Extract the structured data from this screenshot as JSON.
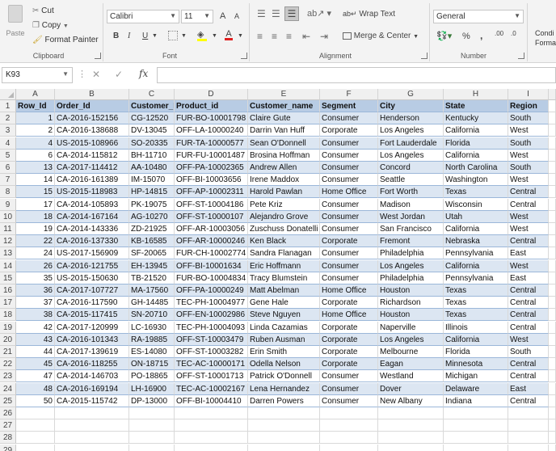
{
  "ribbon": {
    "clipboard": {
      "paste": "Paste",
      "cut": "Cut",
      "copy": "Copy",
      "format_painter": "Format Painter",
      "label": "Clipboard"
    },
    "font": {
      "name": "Calibri",
      "size": "11",
      "bold": "B",
      "italic": "I",
      "underline": "U",
      "grow": "A",
      "shrink": "A",
      "font_color": "A",
      "label": "Font"
    },
    "alignment": {
      "wrap_text": "Wrap Text",
      "merge_center": "Merge & Center",
      "label": "Alignment"
    },
    "number": {
      "format": "General",
      "percent": "%",
      "comma": ",",
      "inc_decimal": ".00",
      "dec_decimal": ".0",
      "label": "Number"
    },
    "styles": {
      "conditional": "Condi",
      "format_as": "Forma"
    }
  },
  "formula_bar": {
    "name_box": "K93",
    "fx": "fx",
    "value": ""
  },
  "columns": [
    "A",
    "B",
    "C",
    "D",
    "E",
    "F",
    "G",
    "H",
    "I"
  ],
  "table": {
    "headers": [
      "Row_Id",
      "Order_Id",
      "Customer_I",
      "Product_id",
      "Customer_name",
      "Segment",
      "City",
      "State",
      "Region"
    ],
    "rows": [
      [
        "1",
        "CA-2016-152156",
        "CG-12520",
        "FUR-BO-10001798",
        "Claire Gute",
        "Consumer",
        "Henderson",
        "Kentucky",
        "South"
      ],
      [
        "2",
        "CA-2016-138688",
        "DV-13045",
        "OFF-LA-10000240",
        "Darrin Van Huff",
        "Corporate",
        "Los Angeles",
        "California",
        "West"
      ],
      [
        "4",
        "US-2015-108966",
        "SO-20335",
        "FUR-TA-10000577",
        "Sean O'Donnell",
        "Consumer",
        "Fort Lauderdale",
        "Florida",
        "South"
      ],
      [
        "6",
        "CA-2014-115812",
        "BH-11710",
        "FUR-FU-10001487",
        "Brosina Hoffman",
        "Consumer",
        "Los Angeles",
        "California",
        "West"
      ],
      [
        "13",
        "CA-2017-114412",
        "AA-10480",
        "OFF-PA-10002365",
        "Andrew Allen",
        "Consumer",
        "Concord",
        "North Carolina",
        "South"
      ],
      [
        "14",
        "CA-2016-161389",
        "IM-15070",
        "OFF-BI-10003656",
        "Irene Maddox",
        "Consumer",
        "Seattle",
        "Washington",
        "West"
      ],
      [
        "15",
        "US-2015-118983",
        "HP-14815",
        "OFF-AP-10002311",
        "Harold Pawlan",
        "Home Office",
        "Fort Worth",
        "Texas",
        "Central"
      ],
      [
        "17",
        "CA-2014-105893",
        "PK-19075",
        "OFF-ST-10004186",
        "Pete Kriz",
        "Consumer",
        "Madison",
        "Wisconsin",
        "Central"
      ],
      [
        "18",
        "CA-2014-167164",
        "AG-10270",
        "OFF-ST-10000107",
        "Alejandro Grove",
        "Consumer",
        "West Jordan",
        "Utah",
        "West"
      ],
      [
        "19",
        "CA-2014-143336",
        "ZD-21925",
        "OFF-AR-10003056",
        "Zuschuss Donatelli",
        "Consumer",
        "San Francisco",
        "California",
        "West"
      ],
      [
        "22",
        "CA-2016-137330",
        "KB-16585",
        "OFF-AR-10000246",
        "Ken Black",
        "Corporate",
        "Fremont",
        "Nebraska",
        "Central"
      ],
      [
        "24",
        "US-2017-156909",
        "SF-20065",
        "FUR-CH-10002774",
        "Sandra Flanagan",
        "Consumer",
        "Philadelphia",
        "Pennsylvania",
        "East"
      ],
      [
        "26",
        "CA-2016-121755",
        "EH-13945",
        "OFF-BI-10001634",
        "Eric Hoffmann",
        "Consumer",
        "Los Angeles",
        "California",
        "West"
      ],
      [
        "35",
        "US-2015-150630",
        "TB-21520",
        "FUR-BO-10004834",
        "Tracy Blumstein",
        "Consumer",
        "Philadelphia",
        "Pennsylvania",
        "East"
      ],
      [
        "36",
        "CA-2017-107727",
        "MA-17560",
        "OFF-PA-10000249",
        "Matt Abelman",
        "Home Office",
        "Houston",
        "Texas",
        "Central"
      ],
      [
        "37",
        "CA-2016-117590",
        "GH-14485",
        "TEC-PH-10004977",
        "Gene Hale",
        "Corporate",
        "Richardson",
        "Texas",
        "Central"
      ],
      [
        "38",
        "CA-2015-117415",
        "SN-20710",
        "OFF-EN-10002986",
        "Steve Nguyen",
        "Home Office",
        "Houston",
        "Texas",
        "Central"
      ],
      [
        "42",
        "CA-2017-120999",
        "LC-16930",
        "TEC-PH-10004093",
        "Linda Cazamias",
        "Corporate",
        "Naperville",
        "Illinois",
        "Central"
      ],
      [
        "43",
        "CA-2016-101343",
        "RA-19885",
        "OFF-ST-10003479",
        "Ruben Ausman",
        "Corporate",
        "Los Angeles",
        "California",
        "West"
      ],
      [
        "44",
        "CA-2017-139619",
        "ES-14080",
        "OFF-ST-10003282",
        "Erin Smith",
        "Corporate",
        "Melbourne",
        "Florida",
        "South"
      ],
      [
        "45",
        "CA-2016-118255",
        "ON-18715",
        "TEC-AC-10000171",
        "Odella Nelson",
        "Corporate",
        "Eagan",
        "Minnesota",
        "Central"
      ],
      [
        "47",
        "CA-2014-146703",
        "PO-18865",
        "OFF-ST-10001713",
        "Patrick O'Donnell",
        "Consumer",
        "Westland",
        "Michigan",
        "Central"
      ],
      [
        "48",
        "CA-2016-169194",
        "LH-16900",
        "TEC-AC-10002167",
        "Lena Hernandez",
        "Consumer",
        "Dover",
        "Delaware",
        "East"
      ],
      [
        "50",
        "CA-2015-115742",
        "DP-13000",
        "OFF-BI-10004410",
        "Darren Powers",
        "Consumer",
        "New Albany",
        "Indiana",
        "Central"
      ]
    ]
  },
  "row_numbers": [
    "1",
    "2",
    "3",
    "4",
    "5",
    "6",
    "7",
    "8",
    "9",
    "10",
    "11",
    "12",
    "13",
    "14",
    "15",
    "16",
    "17",
    "18",
    "19",
    "20",
    "21",
    "22",
    "23",
    "24",
    "25",
    "26",
    "27",
    "28",
    "29"
  ],
  "colors": {
    "band_light": "#dce6f2",
    "header_fill": "#b8cce4"
  }
}
